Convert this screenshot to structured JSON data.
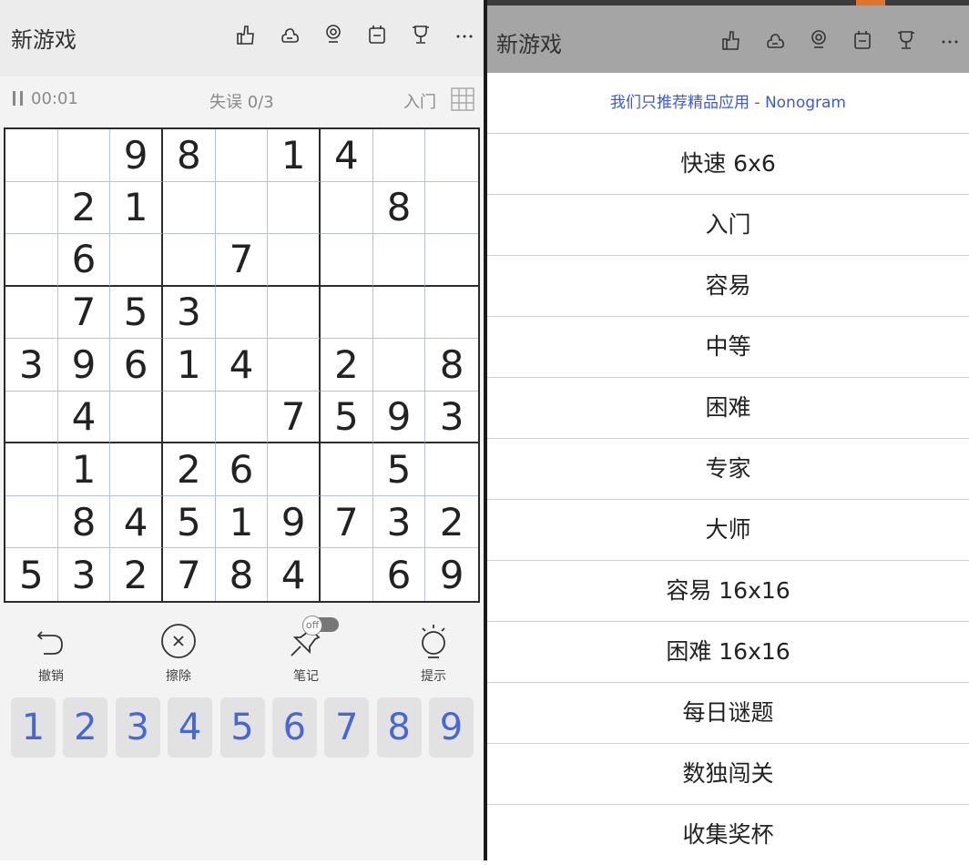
{
  "left": {
    "title": "新游戏",
    "status": {
      "time": "00:01",
      "mistakes": "失误 0/3",
      "level": "入门"
    },
    "board": [
      [
        "",
        "",
        "9",
        "8",
        "",
        "1",
        "4",
        "",
        ""
      ],
      [
        "",
        "2",
        "1",
        "",
        "",
        "",
        "",
        "8",
        ""
      ],
      [
        "",
        "6",
        "",
        "",
        "7",
        "",
        "",
        "",
        ""
      ],
      [
        "",
        "7",
        "5",
        "3",
        "",
        "",
        "",
        "",
        ""
      ],
      [
        "3",
        "9",
        "6",
        "1",
        "4",
        "",
        "2",
        "",
        "8"
      ],
      [
        "",
        "4",
        "",
        "",
        "",
        "7",
        "5",
        "9",
        "3"
      ],
      [
        "",
        "1",
        "",
        "2",
        "6",
        "",
        "",
        "5",
        ""
      ],
      [
        "",
        "8",
        "4",
        "5",
        "1",
        "9",
        "7",
        "3",
        "2"
      ],
      [
        "5",
        "3",
        "2",
        "7",
        "8",
        "4",
        "",
        "6",
        "9"
      ]
    ],
    "actions": {
      "undo": "撤销",
      "erase": "擦除",
      "notes": "笔记",
      "notes_toggle": "off",
      "hint": "提示"
    },
    "numpad": [
      "1",
      "2",
      "3",
      "4",
      "5",
      "6",
      "7",
      "8",
      "9"
    ]
  },
  "right": {
    "title": "新游戏",
    "promo": "我们只推荐精品应用 - Nonogram",
    "menu": [
      "快速 6x6",
      "入门",
      "容易",
      "中等",
      "困难",
      "专家",
      "大师",
      "容易 16x16",
      "困难 16x16",
      "每日谜题",
      "数独闯关",
      "收集奖杯"
    ]
  },
  "colors": {
    "accent": "#4767d4",
    "promo": "#3b5bd6",
    "header_right": "#a5a5a5"
  },
  "icons": [
    "thumbs-up-icon",
    "cloud-icon",
    "badge-icon",
    "calendar-icon",
    "trophy-icon",
    "more-icon"
  ]
}
